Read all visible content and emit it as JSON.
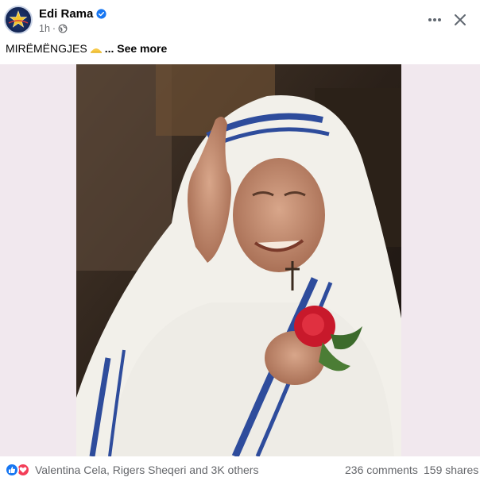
{
  "post": {
    "author": "Edi Rama",
    "time": "1h",
    "caption": "MIRËMËNGJES",
    "see_more": "... See more",
    "footer": {
      "reactions_text": "Valentina Cela, Rigers Sheqeri and 3K others",
      "comments": "236 comments",
      "shares": "159 shares"
    }
  },
  "icons": {
    "verified": "verified-badge-icon",
    "privacy": "globe-icon",
    "more": "more-options-icon",
    "close": "close-icon",
    "caption_emoji": "sun-emoji",
    "reaction_like": "like-icon",
    "reaction_love": "love-icon"
  },
  "colors": {
    "verified": "#1877f2",
    "like": "#1877f2",
    "love": "#f33e58",
    "secondary_text": "#65676b",
    "media_background": "#f1e8ee"
  }
}
